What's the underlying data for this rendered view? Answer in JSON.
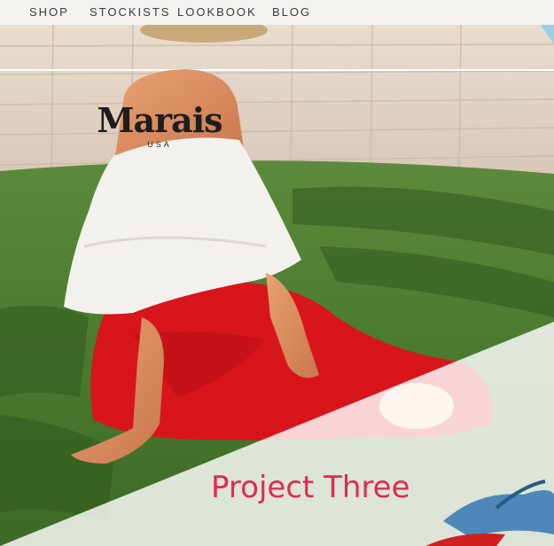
{
  "nav": {
    "items": [
      {
        "label": "SHOP"
      },
      {
        "label": "STOCKISTS"
      },
      {
        "label": "LOOKBOOK"
      },
      {
        "label": "BLOG"
      }
    ]
  },
  "logo": {
    "name": "Marais",
    "sub": "USA"
  },
  "project": {
    "title": "Project Three"
  },
  "colors": {
    "accent": "#e5294d",
    "nav_bg": "#f5f3ef",
    "overlay": "#ffffff"
  }
}
